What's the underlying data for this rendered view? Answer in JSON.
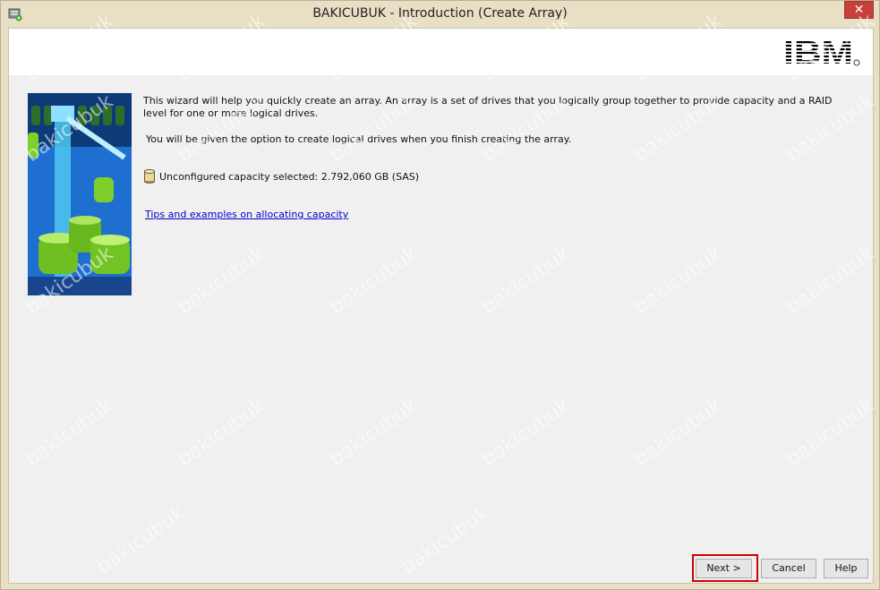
{
  "window": {
    "title": "BAKICUBUK - Introduction (Create Array)",
    "close_glyph": "✕"
  },
  "header": {
    "logo_text": "IBM"
  },
  "content": {
    "intro_text": "This wizard will help you quickly create an array.  An array is a set of drives that you logically group together to provide capacity and a RAID level for one or more logical drives.",
    "option_text": "You will be given the option to create logical drives when you finish creating the array.",
    "capacity_text": "Unconfigured capacity selected: 2.792,060 GB (SAS)",
    "tips_link": "Tips and examples on allocating capacity"
  },
  "buttons": {
    "next": "Next >",
    "cancel": "Cancel",
    "help": "Help"
  },
  "watermark": "bakicubuk",
  "colors": {
    "frame": "#e9dfc4",
    "client": "#f0f0f0",
    "link": "#0000cc",
    "highlight": "#d00000",
    "close": "#c7403a"
  }
}
